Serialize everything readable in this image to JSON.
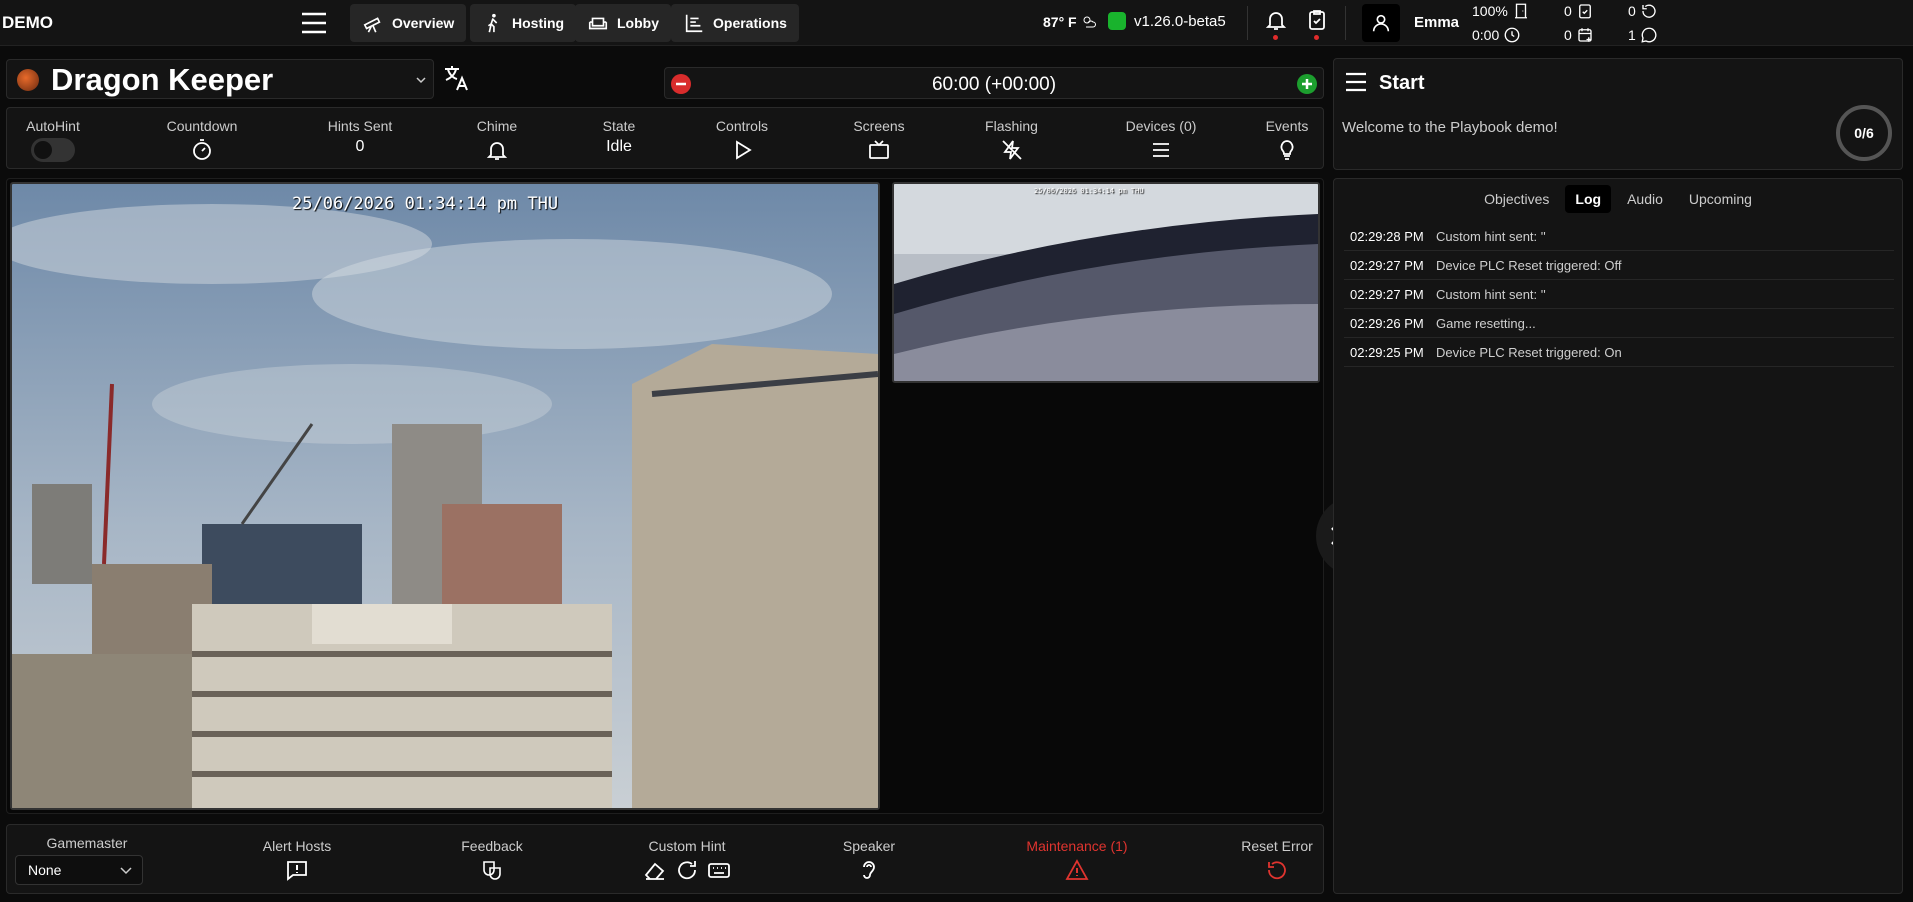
{
  "brand": "DEMO",
  "nav": {
    "overview": "Overview",
    "hosting": "Hosting",
    "lobby": "Lobby",
    "operations": "Operations"
  },
  "weather": {
    "temp": "87° F"
  },
  "version": "v1.26.0-beta5",
  "user": {
    "name": "Emma"
  },
  "stats": {
    "capacity": "100%",
    "time": "0:00",
    "checked": "0",
    "scheduled": "0",
    "refresh": "0",
    "messages": "1"
  },
  "game": {
    "title": "Dragon Keeper"
  },
  "timer": {
    "display": "60:00 (+00:00)"
  },
  "controls": {
    "autohint": "AutoHint",
    "countdown": "Countdown",
    "hints_sent_label": "Hints Sent",
    "hints_sent_value": "0",
    "chime": "Chime",
    "state_label": "State",
    "state_value": "Idle",
    "controls": "Controls",
    "screens": "Screens",
    "flashing": "Flashing",
    "devices": "Devices (0)",
    "events": "Events"
  },
  "cameras": {
    "cam1_timestamp": "25/06/2026 01:34:14 pm THU",
    "cam2_timestamp": "25/06/2026 01:34:14 pm THU"
  },
  "bottom": {
    "gamemaster_label": "Gamemaster",
    "gamemaster_value": "None",
    "alert_hosts": "Alert Hosts",
    "feedback": "Feedback",
    "custom_hint": "Custom Hint",
    "speaker": "Speaker",
    "maintenance": "Maintenance (1)",
    "reset_error": "Reset Error"
  },
  "start_panel": {
    "title": "Start",
    "welcome": "Welcome to the Playbook demo!",
    "progress_done": "0",
    "progress_total": "6"
  },
  "tabs": [
    "Objectives",
    "Log",
    "Audio",
    "Upcoming"
  ],
  "log": [
    {
      "time": "02:29:28 PM",
      "msg": "Custom hint sent: ''"
    },
    {
      "time": "02:29:27 PM",
      "msg": "Device PLC Reset triggered: Off"
    },
    {
      "time": "02:29:27 PM",
      "msg": "Custom hint sent: ''"
    },
    {
      "time": "02:29:26 PM",
      "msg": "Game resetting..."
    },
    {
      "time": "02:29:25 PM",
      "msg": "Device PLC Reset triggered: On"
    }
  ],
  "colors": {
    "accent_red": "#e02b2b",
    "status_green": "#19b32d",
    "bg": "#0b0b0b",
    "panel": "#141414"
  }
}
